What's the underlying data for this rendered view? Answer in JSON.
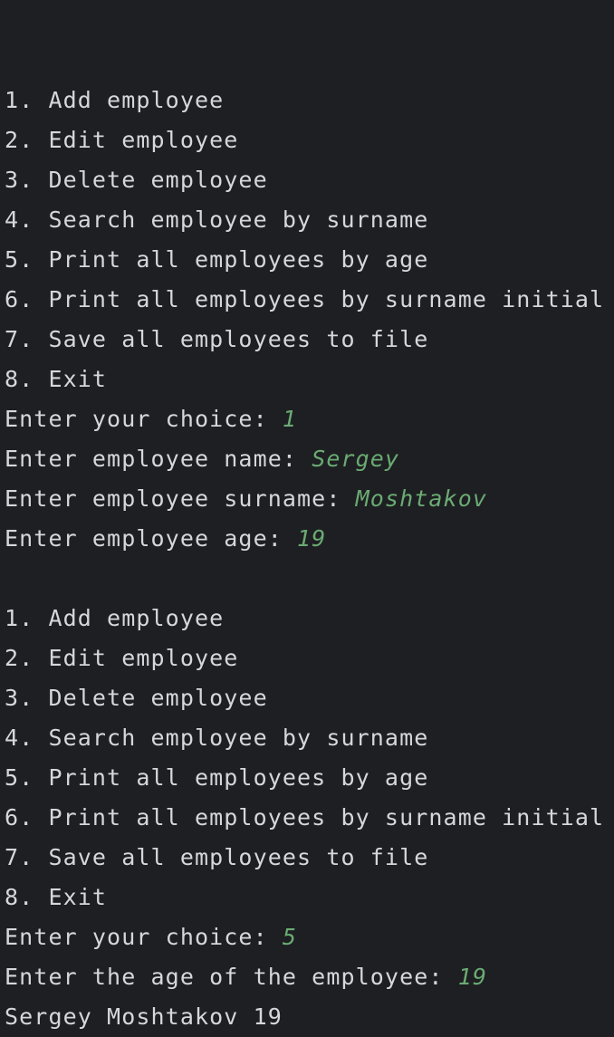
{
  "console": {
    "lines": [
      {
        "text": "",
        "input": ""
      },
      {
        "text": "1. Add employee",
        "input": ""
      },
      {
        "text": "2. Edit employee",
        "input": ""
      },
      {
        "text": "3. Delete employee",
        "input": ""
      },
      {
        "text": "4. Search employee by surname",
        "input": ""
      },
      {
        "text": "5. Print all employees by age",
        "input": ""
      },
      {
        "text": "6. Print all employees by surname initial",
        "input": ""
      },
      {
        "text": "7. Save all employees to file",
        "input": ""
      },
      {
        "text": "8. Exit",
        "input": ""
      },
      {
        "text": "Enter your choice: ",
        "input": "1"
      },
      {
        "text": "Enter employee name: ",
        "input": "Sergey"
      },
      {
        "text": "Enter employee surname: ",
        "input": "Moshtakov"
      },
      {
        "text": "Enter employee age: ",
        "input": "19"
      },
      {
        "text": "",
        "input": ""
      },
      {
        "text": "1. Add employee",
        "input": ""
      },
      {
        "text": "2. Edit employee",
        "input": ""
      },
      {
        "text": "3. Delete employee",
        "input": ""
      },
      {
        "text": "4. Search employee by surname",
        "input": ""
      },
      {
        "text": "5. Print all employees by age",
        "input": ""
      },
      {
        "text": "6. Print all employees by surname initial",
        "input": ""
      },
      {
        "text": "7. Save all employees to file",
        "input": ""
      },
      {
        "text": "8. Exit",
        "input": ""
      },
      {
        "text": "Enter your choice: ",
        "input": "5"
      },
      {
        "text": "Enter the age of the employee: ",
        "input": "19"
      },
      {
        "text": "Sergey Moshtakov 19",
        "input": ""
      }
    ]
  },
  "colors": {
    "background": "#1e1f22",
    "output_text": "#d6d7da",
    "user_input": "#6aab73"
  }
}
